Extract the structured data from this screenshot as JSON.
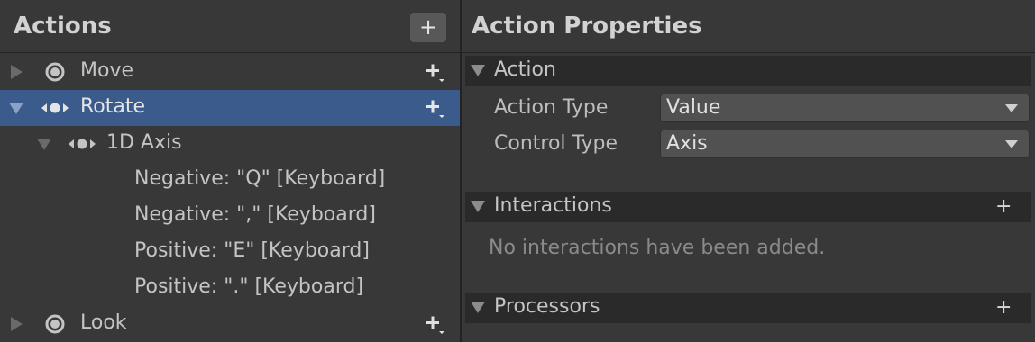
{
  "actions_panel": {
    "title": "Actions",
    "add_label": "+",
    "rows": [
      {
        "label": "Move"
      },
      {
        "label": "Rotate"
      },
      {
        "label": "1D Axis"
      },
      {
        "label": "Negative: \"Q\" [Keyboard]"
      },
      {
        "label": "Negative: \",\" [Keyboard]"
      },
      {
        "label": "Positive: \"E\" [Keyboard]"
      },
      {
        "label": "Positive: \".\" [Keyboard]"
      },
      {
        "label": "Look"
      }
    ],
    "selected_row": "Rotate"
  },
  "properties_panel": {
    "title": "Action Properties",
    "action_section": {
      "title": "Action",
      "action_type_label": "Action Type",
      "action_type_value": "Value",
      "control_type_label": "Control Type",
      "control_type_value": "Axis"
    },
    "interactions_section": {
      "title": "Interactions",
      "add_label": "+",
      "empty_message": "No interactions have been added."
    },
    "processors_section": {
      "title": "Processors",
      "add_label": "+"
    }
  },
  "colors": {
    "background": "#383838",
    "selection": "#3a5b8c",
    "section_header": "#2a2a2a"
  }
}
